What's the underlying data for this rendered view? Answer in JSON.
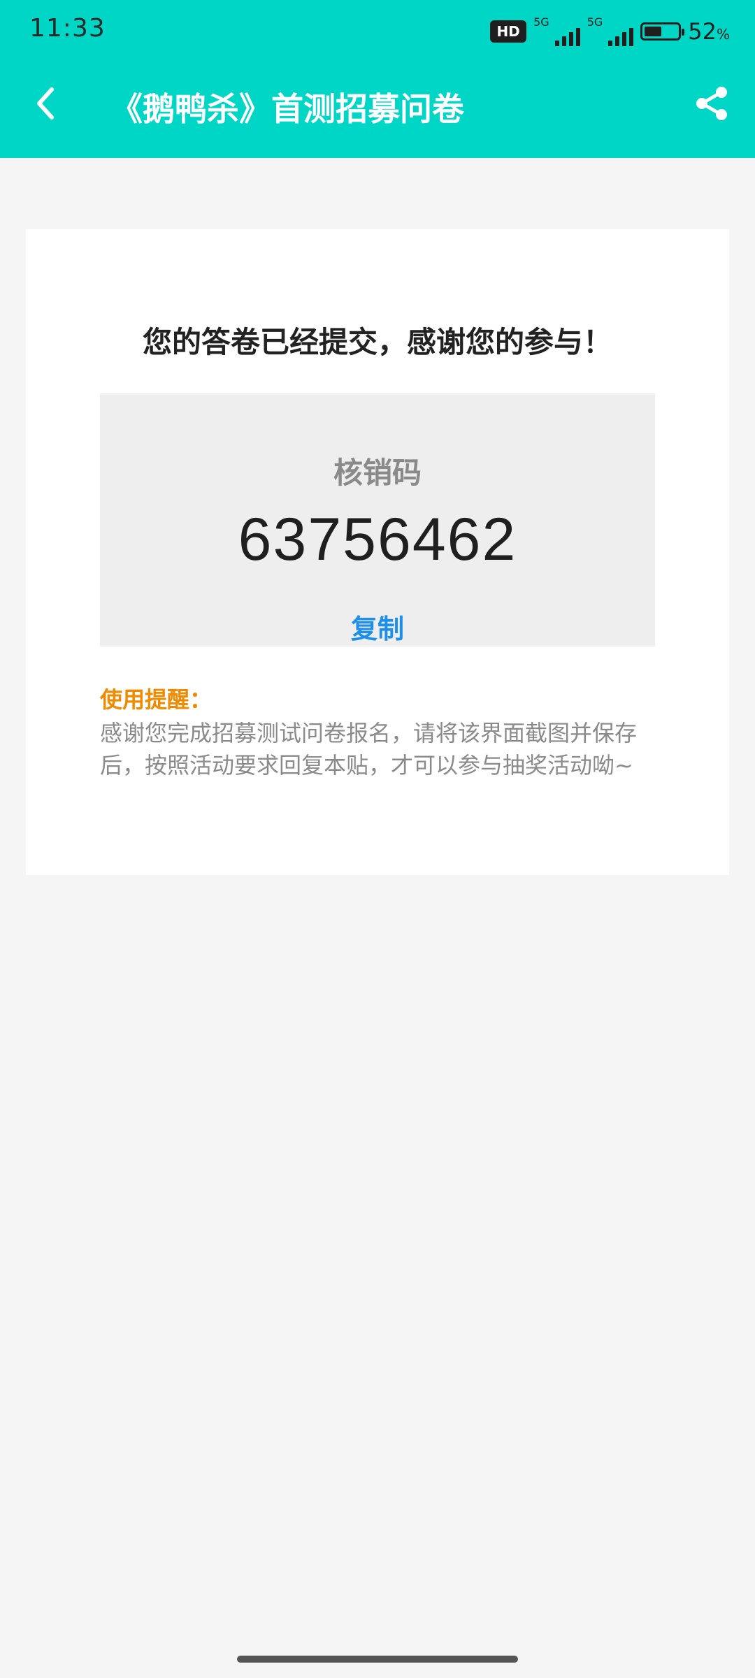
{
  "status_bar": {
    "time": "11:33",
    "hd_label": "HD",
    "sim1_label": "5G",
    "sim2_label": "5G",
    "battery_percent": "52",
    "battery_unit": "%",
    "battery_level": 0.52
  },
  "nav": {
    "title": "《鹅鸭杀》首测招募问卷",
    "back_icon": "chevron-left-icon",
    "share_icon": "share-icon"
  },
  "result": {
    "title": "您的答卷已经提交，感谢您的参与！",
    "code_label": "核销码",
    "code_value": "63756462",
    "copy_label": "复制"
  },
  "tip": {
    "title": "使用提醒：",
    "text": "感谢您完成招募测试问卷报名，请将该界面截图并保存后，按照活动要求回复本贴，才可以参与抽奖活动呦~"
  },
  "colors": {
    "header_bg": "#00d6c5",
    "accent_link": "#1e8fe8",
    "tip_title": "#f08a00"
  }
}
